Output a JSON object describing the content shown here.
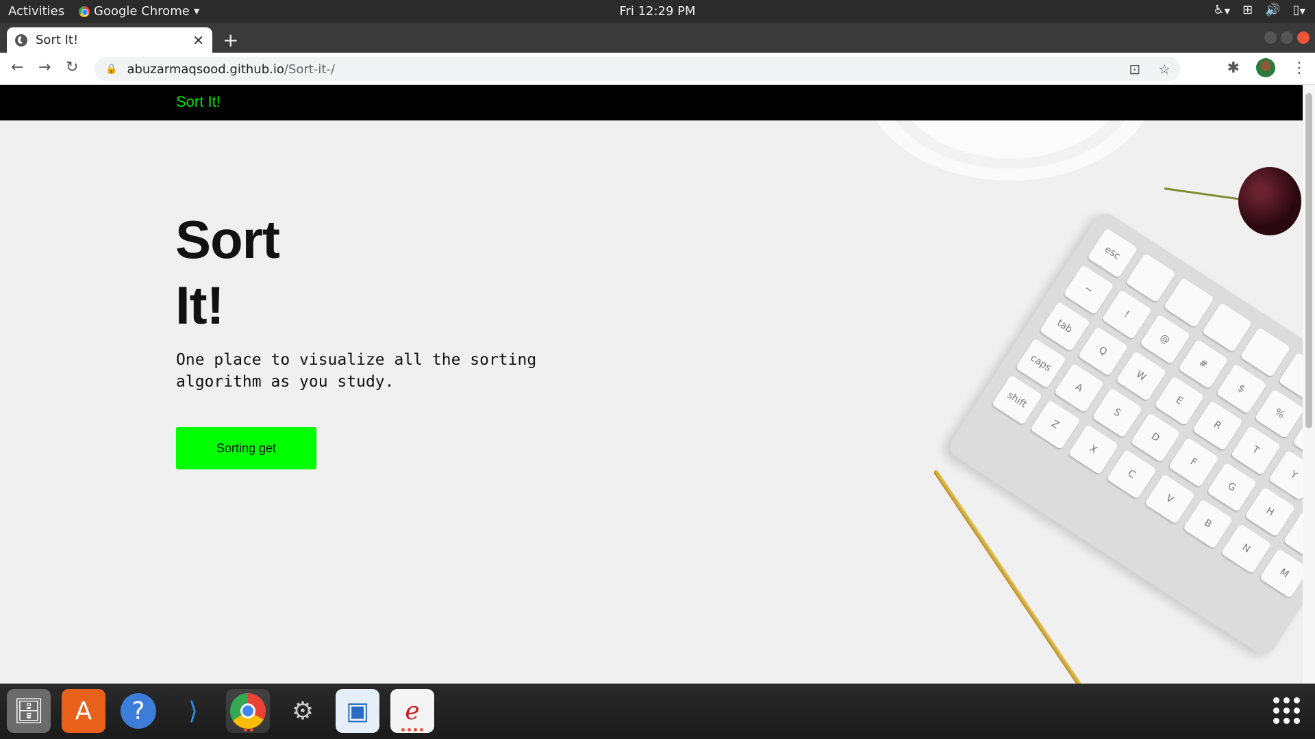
{
  "system": {
    "activities": "Activities",
    "app_name": "Google Chrome",
    "clock": "Fri 12:29 PM"
  },
  "browser": {
    "tab_title": "Sort It!",
    "url_host": "abuzarmaqsood.github.io",
    "url_path": "/Sort-it-/"
  },
  "page": {
    "brand": "Sort It!",
    "hero_line1": "Sort",
    "hero_line2": "It!",
    "subtitle": "One place to visualize all the sorting algorithm as you study.",
    "cta_label": "Sorting get"
  },
  "colors": {
    "accent": "#00ff00",
    "brand_text": "#00e600",
    "navbar": "#000000"
  },
  "dock": {
    "apps": [
      "files-icon",
      "software-center-icon",
      "help-icon",
      "vscode-icon",
      "chrome-icon",
      "settings-icon",
      "image-viewer-icon",
      "evince-icon"
    ]
  }
}
